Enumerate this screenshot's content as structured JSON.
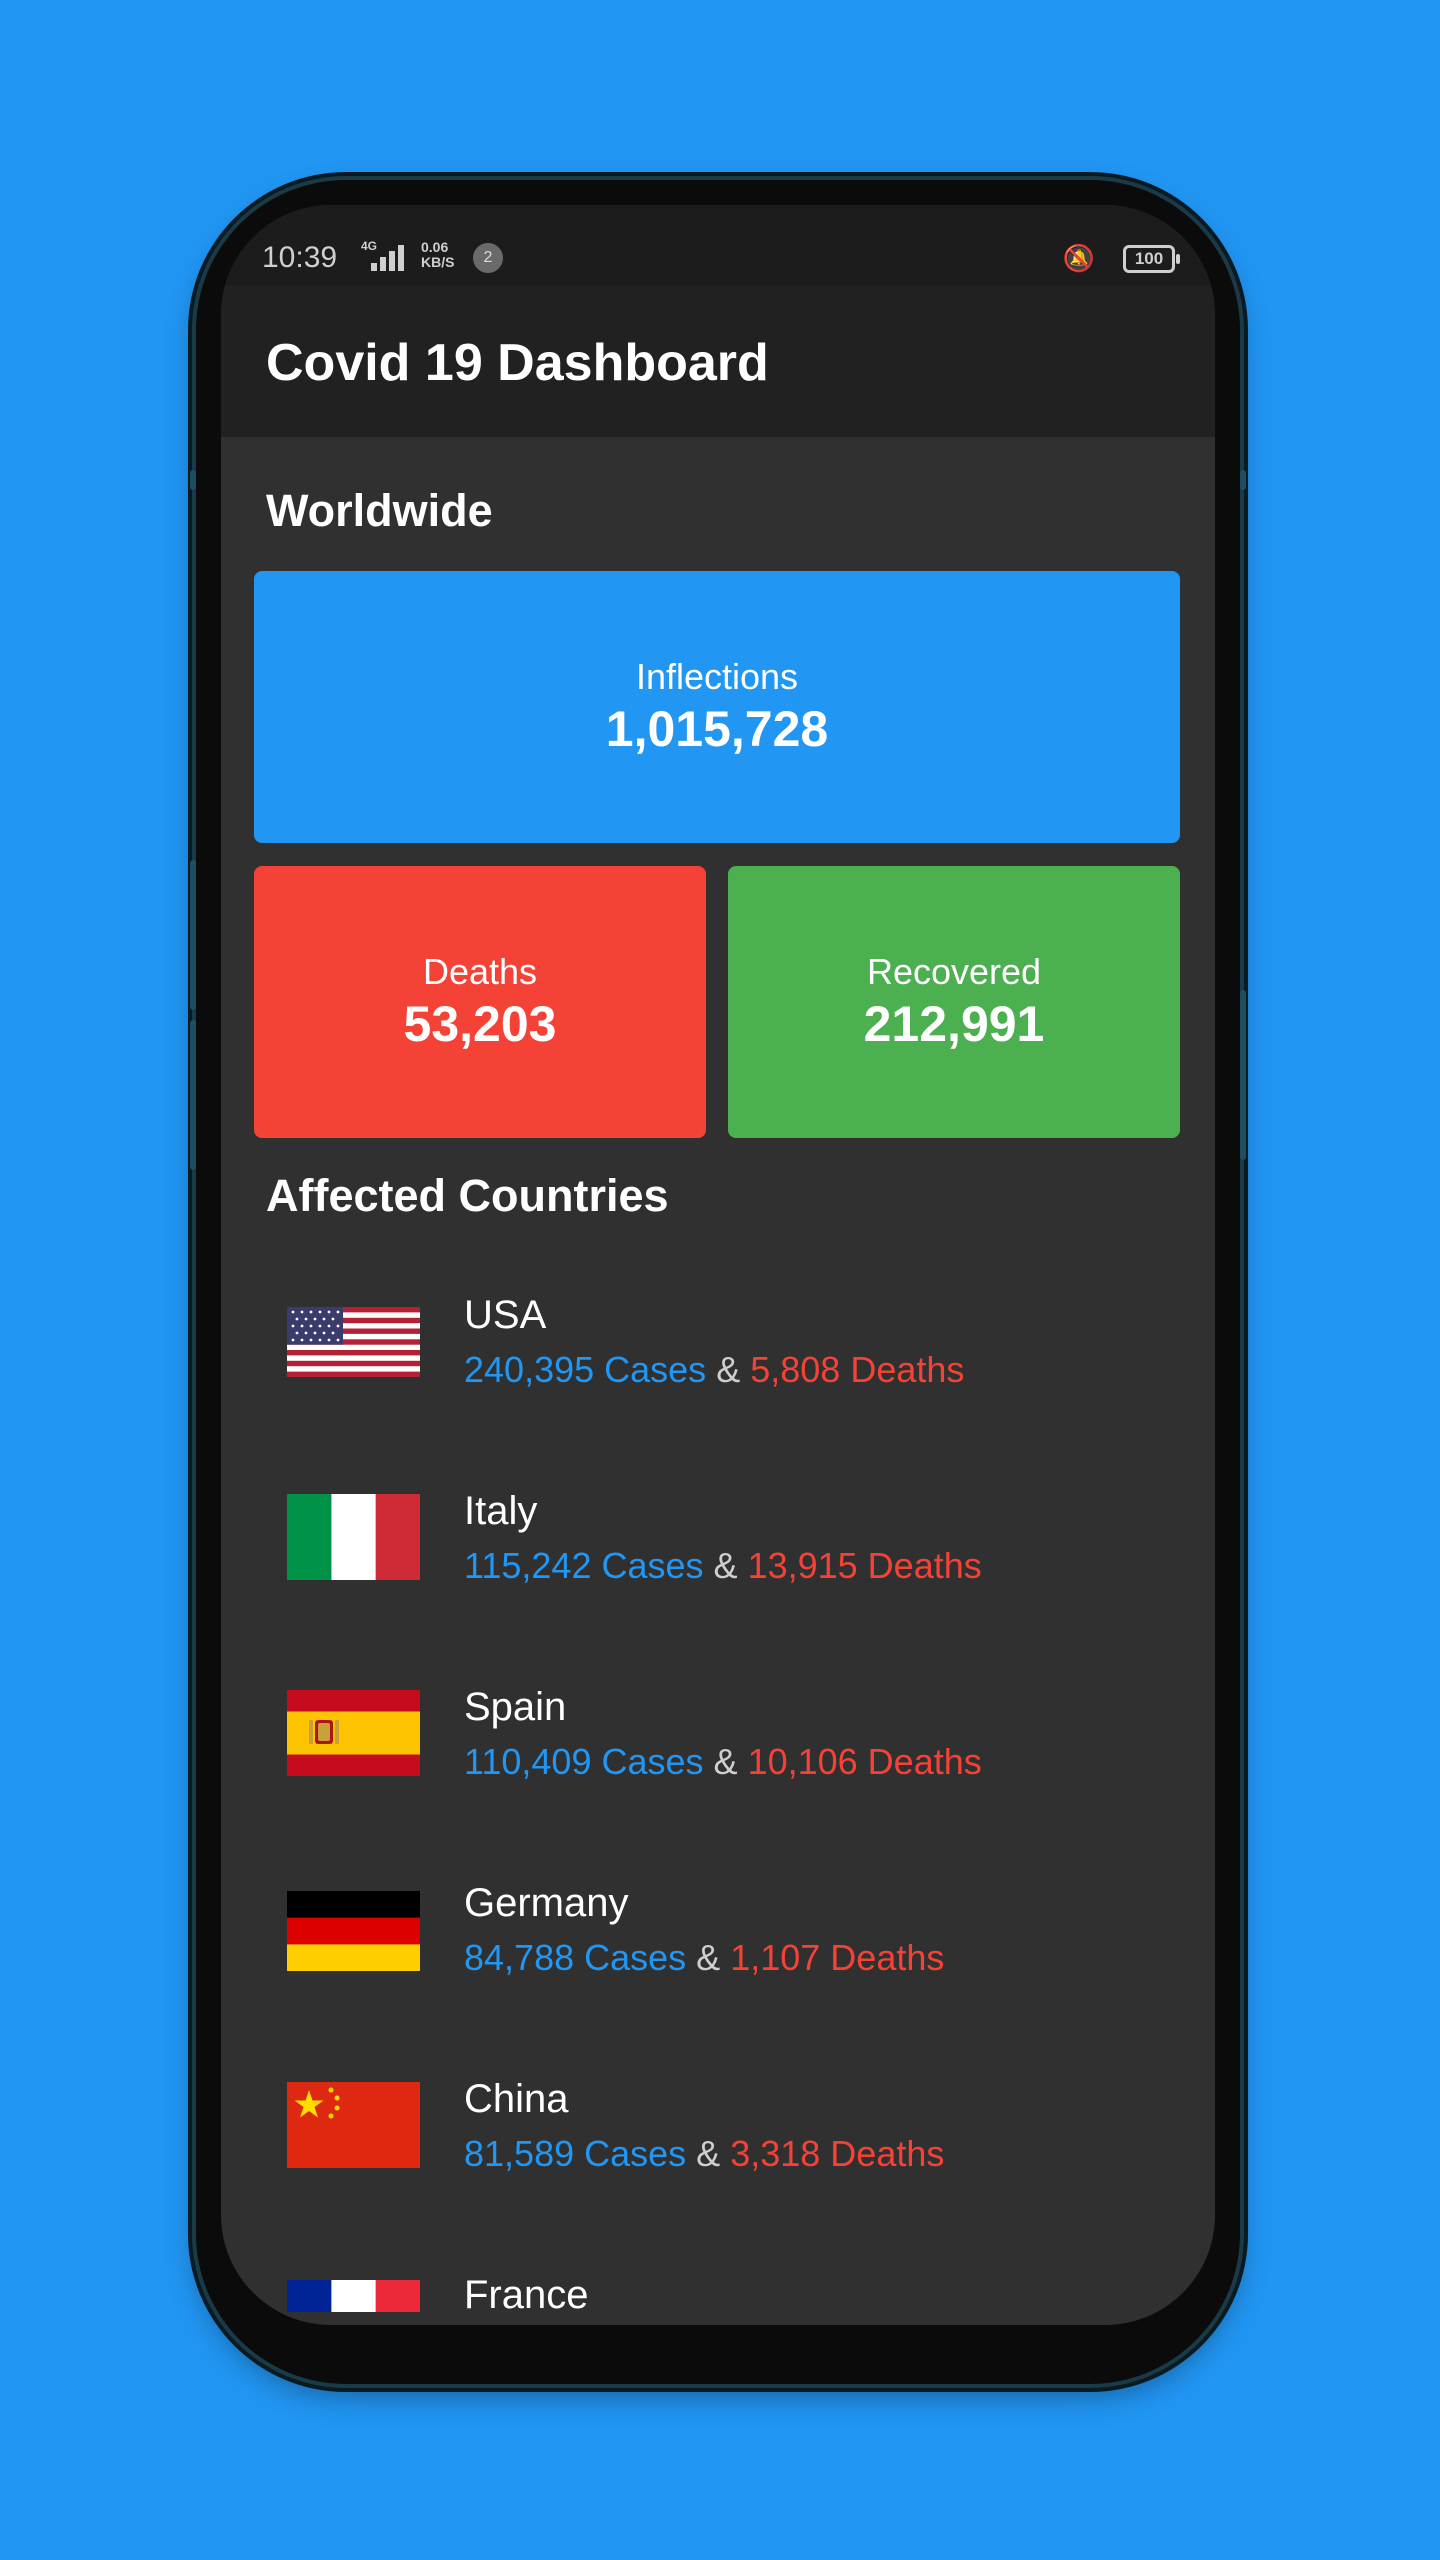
{
  "status_bar": {
    "time": "10:39",
    "network": "4G",
    "speed_value": "0.06",
    "speed_unit": "KB/S",
    "notification_count": "2",
    "battery": "100"
  },
  "app_bar": {
    "title": "Covid 19 Dashboard"
  },
  "worldwide": {
    "title": "Worldwide",
    "infections": {
      "label": "Inflections",
      "value": "1,015,728",
      "color": "#2196f3"
    },
    "deaths": {
      "label": "Deaths",
      "value": "53,203",
      "color": "#f44336"
    },
    "recovered": {
      "label": "Recovered",
      "value": "212,991",
      "color": "#4caf50"
    }
  },
  "countries_title": "Affected Countries",
  "countries": [
    {
      "name": "USA",
      "cases": "240,395 Cases",
      "sep": "&",
      "deaths": "5,808 Deaths",
      "flag": "usa-flag-icon"
    },
    {
      "name": "Italy",
      "cases": "115,242 Cases",
      "sep": "&",
      "deaths": "13,915 Deaths",
      "flag": "italy-flag-icon"
    },
    {
      "name": "Spain",
      "cases": "110,409 Cases",
      "sep": "&",
      "deaths": "10,106 Deaths",
      "flag": "spain-flag-icon"
    },
    {
      "name": "Germany",
      "cases": "84,788 Cases",
      "sep": "&",
      "deaths": "1,107 Deaths",
      "flag": "germany-flag-icon"
    },
    {
      "name": "China",
      "cases": "81,589 Cases",
      "sep": "&",
      "deaths": "3,318 Deaths",
      "flag": "china-flag-icon"
    },
    {
      "name": "France",
      "flag": "france-flag-icon"
    }
  ],
  "colors": {
    "background": "#2196f3",
    "screen_bg": "#303030",
    "app_bar_bg": "#212121",
    "cases_text": "#2196f3",
    "deaths_text": "#f44336"
  }
}
